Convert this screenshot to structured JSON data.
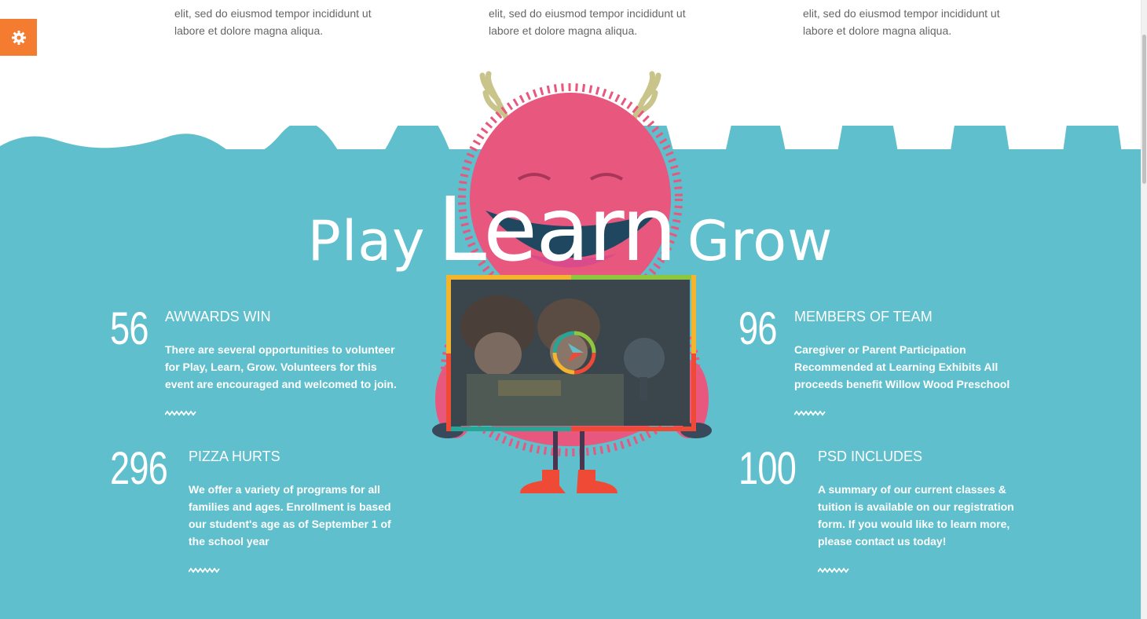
{
  "top_columns": [
    {
      "line1": "elit, sed do eiusmod tempor incididunt ut",
      "line2": "labore et dolore magna aliqua."
    },
    {
      "line1": "elit, sed do eiusmod tempor incididunt ut",
      "line2": "labore et dolore magna aliqua."
    },
    {
      "line1": "elit, sed do eiusmod tempor incididunt ut",
      "line2": "labore et dolore magna aliqua."
    }
  ],
  "settings": {
    "icon": "gear-icon",
    "color": "#f47c30"
  },
  "headline": {
    "play": "Play",
    "learn": "Learn",
    "grow": "Grow"
  },
  "video": {
    "icon": "play-icon"
  },
  "stats": [
    {
      "number": "56",
      "title": "AWWARDS WIN",
      "description": "There are several opportunities to volunteer for Play, Learn, Grow. Volunteers for this event are encouraged and welcomed to join."
    },
    {
      "number": "296",
      "title": "PIZZA HURTS",
      "description": "We offer a variety of programs for all families and ages. Enrollment is based our student's age as of September 1 of the school year"
    },
    {
      "number": "96",
      "title": "MEMBERS OF TEAM",
      "description": "Caregiver or Parent Participation Recommended at Learning Exhibits All proceeds benefit Willow Wood Preschool"
    },
    {
      "number": "100",
      "title": "PSD INCLUDES",
      "description": "A summary of our current classes & tuition is available on our registration form. If you would like to learn more, please contact us today!"
    }
  ],
  "colors": {
    "teal": "#5fbfcc",
    "wave": "#5fbfcc",
    "accent": "#f47c30",
    "monster": "#e8577d"
  }
}
